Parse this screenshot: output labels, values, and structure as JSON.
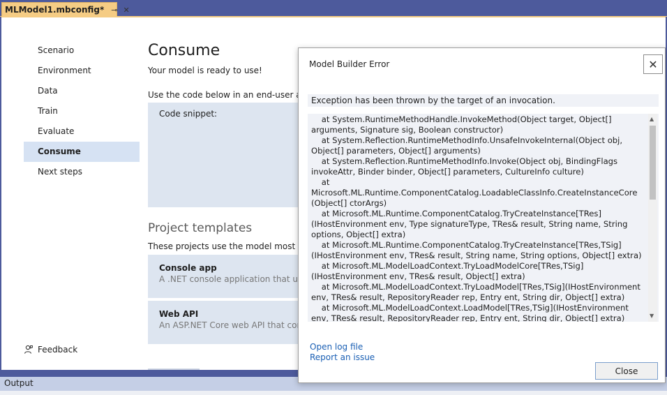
{
  "tab": {
    "title": "MLModel1.mbconfig*",
    "pin_icon": "pin-icon",
    "close_icon": "close-icon"
  },
  "nav": {
    "items": [
      {
        "label": "Scenario",
        "active": false
      },
      {
        "label": "Environment",
        "active": false
      },
      {
        "label": "Data",
        "active": false
      },
      {
        "label": "Train",
        "active": false
      },
      {
        "label": "Evaluate",
        "active": false
      },
      {
        "label": "Consume",
        "active": true
      },
      {
        "label": "Next steps",
        "active": false
      }
    ],
    "feedback_label": "Feedback"
  },
  "main": {
    "title": "Consume",
    "ready_text": "Your model is ready to use!",
    "use_code_text": "Use the code below in an end-user application",
    "snippet_label": "Code snippet:",
    "templates_title": "Project templates",
    "templates_desc": "These projects use the model most recently",
    "templates": [
      {
        "name": "Console app",
        "desc": "A .NET console application that uses your model"
      },
      {
        "name": "Web API",
        "desc": "An ASP.NET Core web API that consumes your model"
      }
    ]
  },
  "output": {
    "label": "Output"
  },
  "dialog": {
    "title": "Model Builder Error",
    "exception_message": "Exception has been thrown by the target of an invocation.",
    "stack_trace": "    at System.RuntimeMethodHandle.InvokeMethod(Object target, Object[] arguments, Signature sig, Boolean constructor)\n    at System.Reflection.RuntimeMethodInfo.UnsafeInvokeInternal(Object obj, Object[] parameters, Object[] arguments)\n    at System.Reflection.RuntimeMethodInfo.Invoke(Object obj, BindingFlags invokeAttr, Binder binder, Object[] parameters, CultureInfo culture)\n    at Microsoft.ML.Runtime.ComponentCatalog.LoadableClassInfo.CreateInstanceCore (Object[] ctorArgs)\n    at Microsoft.ML.Runtime.ComponentCatalog.TryCreateInstance[TRes] (IHostEnvironment env, Type signatureType, TRes& result, String name, String options, Object[] extra)\n    at Microsoft.ML.Runtime.ComponentCatalog.TryCreateInstance[TRes,TSig] (IHostEnvironment env, TRes& result, String name, String options, Object[] extra)\n    at Microsoft.ML.ModelLoadContext.TryLoadModelCore[TRes,TSig](IHostEnvironment env, TRes& result, Object[] extra)\n    at Microsoft.ML.ModelLoadContext.TryLoadModel[TRes,TSig](IHostEnvironment env, TRes& result, RepositoryReader rep, Entry ent, String dir, Object[] extra)\n    at Microsoft.ML.ModelLoadContext.LoadModel[TRes,TSig](IHostEnvironment env, TRes& result, RepositoryReader rep, Entry ent, String dir, Object[] extra)\n    at Microsoft.ML.ModelLoadContext.LoadModelOrNull[TRes,TSig](IHostEnvironment",
    "open_log_label": "Open log file",
    "report_issue_label": "Report an issue",
    "close_button_label": "Close",
    "close_icon": "close-icon"
  },
  "colors": {
    "frame": "#4d5a9c",
    "tab_active": "#f5cc84",
    "nav_active": "#d6e2f3",
    "card_bg": "#dde5f0",
    "link": "#1a5fb4"
  }
}
